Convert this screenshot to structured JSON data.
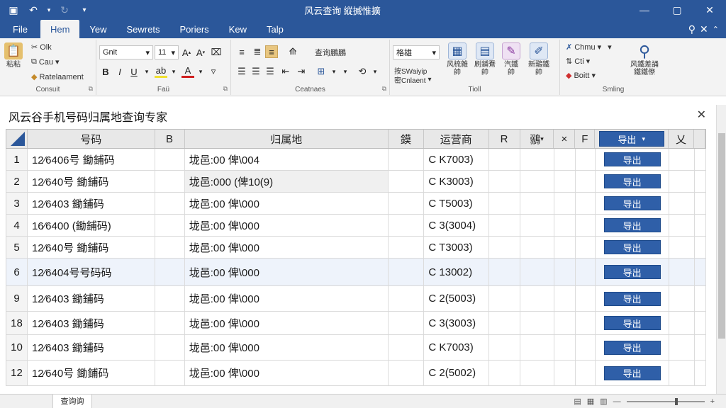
{
  "window": {
    "title": "风云查询  縱搣惟擴"
  },
  "tabs": [
    {
      "label": "File"
    },
    {
      "label": "Hem"
    },
    {
      "label": "Yew"
    },
    {
      "label": "Sewrets"
    },
    {
      "label": "Poriers"
    },
    {
      "label": "Kew"
    },
    {
      "label": "Talp"
    }
  ],
  "ribbon": {
    "clipboard": {
      "label": "Consuit",
      "paste": "粘粘",
      "cut": "Olk",
      "copy": "Cau",
      "format_painter": "Ratelaament"
    },
    "font": {
      "label": "Faü",
      "font_name": "Gnit",
      "font_size": "11"
    },
    "alignment": {
      "label": "Ceatnaes",
      "wrap": "查询鵬鵬"
    },
    "number": {
      "label": "Tioll",
      "format": "格雄",
      "cond1": "按SWaiyip",
      "cond2": "密Cnlaent"
    },
    "styles": {
      "b1": "风梳雜\n帥",
      "b2": "刷鋪鴌\n帥",
      "b3": "汽鐵\n帥",
      "b4": "新鶸鐵\n帥"
    },
    "editing": {
      "label": "Smling",
      "chm": "Chmu",
      "cti": "Cti",
      "boit": "Boitt",
      "find": "风鐵差誦\n鐵鐵僚"
    }
  },
  "sheet": {
    "title": "风云谷手机号码归属地查询专家",
    "tab_name": "查询询"
  },
  "grid": {
    "headers": [
      "号码",
      "B",
      "归属地",
      "鏌",
      "运营商",
      "R",
      "鶸",
      "×",
      "F",
      "导出",
      "乂"
    ],
    "export_label": "导出",
    "rows": [
      {
        "n": "1",
        "phone": "12⁄6406号 鋤鋪码",
        "loc": "垅邑:00 俾\\004",
        "op": "C K7003)",
        "btn": "导出"
      },
      {
        "n": "2",
        "phone": "12⁄640号 鋤鋪码",
        "loc": "垅邑:000 (俾10(9)",
        "op": "C K3003)",
        "btn": "导出"
      },
      {
        "n": "3",
        "phone": "12⁄6403 鋤鋪码",
        "loc": "垅邑:00 俾\\000",
        "op": "C T5003)",
        "btn": "导出"
      },
      {
        "n": "4",
        "phone": "16⁄6400 (鋤鋪码)",
        "loc": "垅邑:00 俾\\000",
        "op": "C 3(3004)",
        "btn": "导出"
      },
      {
        "n": "5",
        "phone": "12⁄640号 鋤鋪码",
        "loc": "垅邑:00 俾\\000",
        "op": "C T3003)",
        "btn": "导出"
      },
      {
        "n": "6",
        "phone": "12⁄6404号号码码",
        "loc": "垅邑:00 俾\\000",
        "op": "C 13002)",
        "btn": "导出"
      },
      {
        "n": "9",
        "phone": "12⁄6403 鋤鋪码",
        "loc": "垅邑:00 俾\\000",
        "op": "C 2(5003)",
        "btn": "导出"
      },
      {
        "n": "18",
        "phone": "12⁄6403 鋤鋪码",
        "loc": "垅邑:00 俾\\000",
        "op": "C 3(3003)",
        "btn": "导出"
      },
      {
        "n": "10",
        "phone": "12⁄6403 鋤鋪码",
        "loc": "垅邑:00 俾\\000",
        "op": "C K7003)",
        "btn": "导出"
      },
      {
        "n": "12",
        "phone": "12⁄640号 鋤鋪码",
        "loc": "垅邑:00 俾\\000",
        "op": "C 2(5002)",
        "btn": "导出"
      }
    ]
  },
  "icons": {
    "save": "save-icon",
    "undo": "undo-icon",
    "redo": "redo-icon",
    "search": "search-icon",
    "close": "close-icon"
  },
  "colors": {
    "titlebar": "#2b579a",
    "export_button": "#2f5fa8"
  }
}
